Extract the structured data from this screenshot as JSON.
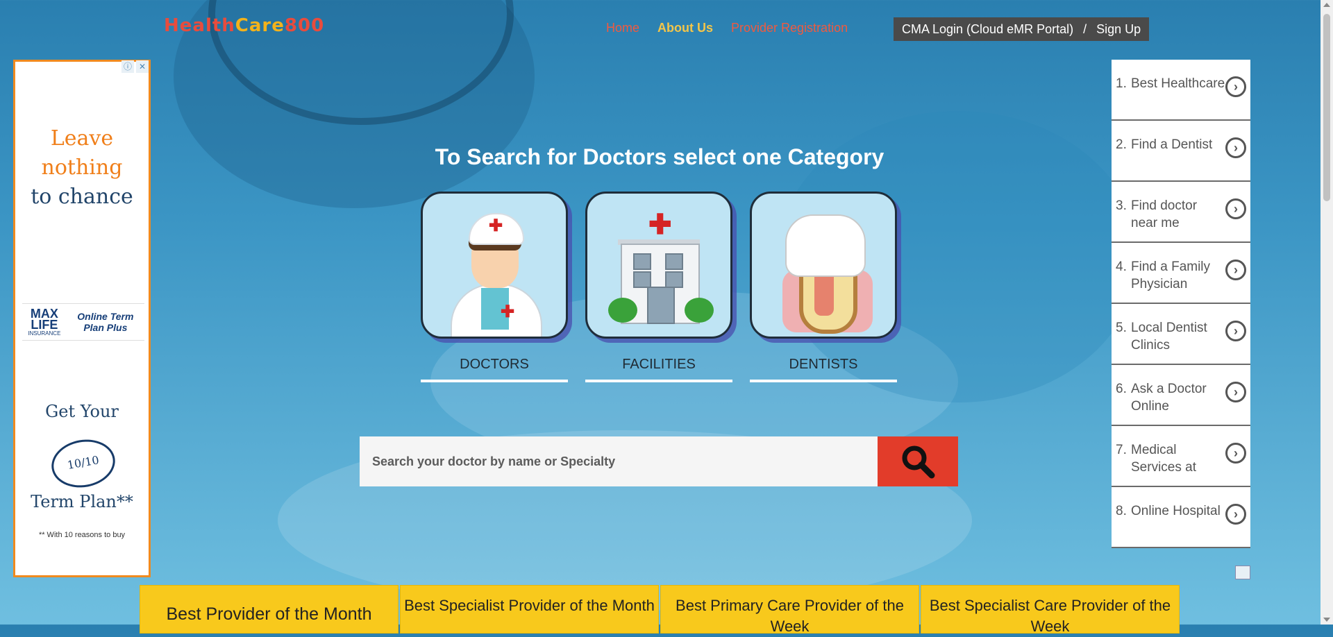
{
  "brand": {
    "part1": "Health",
    "part2": "Care",
    "part3": "800"
  },
  "nav": {
    "home": "Home",
    "about": "About Us",
    "provider_registration": "Provider Registration"
  },
  "auth": {
    "login": "CMA Login (Cloud eMR Portal)",
    "separator": "/",
    "signup": "Sign Up"
  },
  "ad": {
    "lead_line1": "Leave",
    "lead_line2": "nothing",
    "lead_line3": "to chance",
    "logo_brand": "MAX LIFE",
    "logo_brand_sub": "INSURANCE",
    "logo_product": "Online Term Plan Plus",
    "get_your": "Get Your",
    "badge": "10/10",
    "term_plan": "Term Plan**",
    "fine_print": "** With 10 reasons to buy"
  },
  "main": {
    "heading": "To Search for Doctors select one Category"
  },
  "categories": [
    {
      "label": "DOCTORS"
    },
    {
      "label": "FACILITIES"
    },
    {
      "label": "DENTISTS"
    }
  ],
  "search": {
    "placeholder": "Search your doctor by name or Specialty"
  },
  "side_links": [
    {
      "num": "1.",
      "text": "Best Healthcare"
    },
    {
      "num": "2.",
      "text": "Find a Dentist"
    },
    {
      "num": "3.",
      "text": "Find doctor near me"
    },
    {
      "num": "4.",
      "text": "Find a Family Physician"
    },
    {
      "num": "5.",
      "text": "Local Dentist Clinics"
    },
    {
      "num": "6.",
      "text": "Ask a Doctor Online"
    },
    {
      "num": "7.",
      "text": "Medical Services at"
    },
    {
      "num": "8.",
      "text": "Online Hospital"
    }
  ],
  "awards": [
    "Best Provider of the Month",
    "Best Specialist Provider of the Month",
    "Best Primary Care Provider of the Week",
    "Best Specialist Care Provider of the Week"
  ],
  "colors": {
    "accent_red": "#e23c2a",
    "award_yellow": "#f8c91c",
    "ad_orange": "#f08a1f"
  }
}
